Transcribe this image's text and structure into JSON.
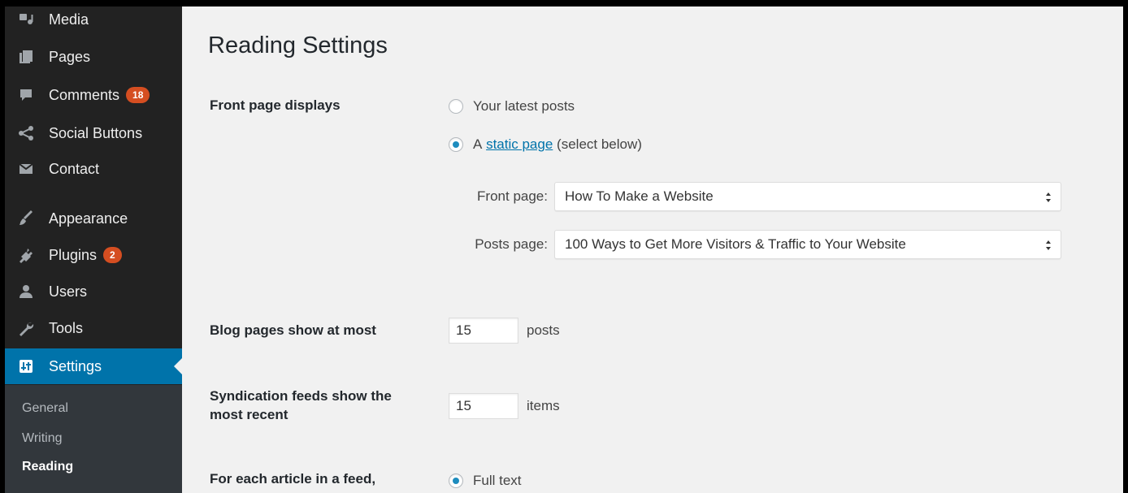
{
  "sidebar": {
    "items": [
      {
        "name": "media",
        "label": "Media",
        "icon": "media-icon"
      },
      {
        "name": "pages",
        "label": "Pages",
        "icon": "pages-icon"
      },
      {
        "name": "comments",
        "label": "Comments",
        "icon": "comments-icon",
        "badge": "18"
      },
      {
        "name": "social-buttons",
        "label": "Social Buttons",
        "icon": "share-icon"
      },
      {
        "name": "contact",
        "label": "Contact",
        "icon": "envelope-icon"
      },
      {
        "name": "appearance",
        "label": "Appearance",
        "icon": "paintbrush-icon"
      },
      {
        "name": "plugins",
        "label": "Plugins",
        "icon": "plugin-icon",
        "badge": "2"
      },
      {
        "name": "users",
        "label": "Users",
        "icon": "user-icon"
      },
      {
        "name": "tools",
        "label": "Tools",
        "icon": "wrench-icon"
      },
      {
        "name": "settings",
        "label": "Settings",
        "icon": "settings-icon",
        "active": true
      }
    ],
    "submenu": [
      "General",
      "Writing",
      "Reading"
    ],
    "current_submenu": "Reading"
  },
  "main": {
    "title": "Reading Settings",
    "front_page": {
      "label": "Front page displays",
      "option_latest": "Your latest posts",
      "option_static_prefix": "A",
      "option_static_link": "static page",
      "option_static_suffix": "(select below)",
      "selected": "static",
      "front_page_label": "Front page:",
      "front_page_value": "How To Make a Website",
      "posts_page_label": "Posts page:",
      "posts_page_value": "100 Ways to Get More Visitors & Traffic to Your Website"
    },
    "blog_pages": {
      "label": "Blog pages show at most",
      "value": "15",
      "unit": "posts"
    },
    "syndication": {
      "label_line1": "Syndication feeds show the",
      "label_line2": "most recent",
      "value": "15",
      "unit": "items"
    },
    "feed_article": {
      "label": "For each article in a feed,",
      "option_full": "Full text",
      "selected": "full"
    }
  },
  "colors": {
    "sidebar_bg": "#222222",
    "submenu_bg": "#32373c",
    "active_bg": "#0073aa",
    "badge": "#d54e21",
    "content_bg": "#f1f1f1"
  }
}
